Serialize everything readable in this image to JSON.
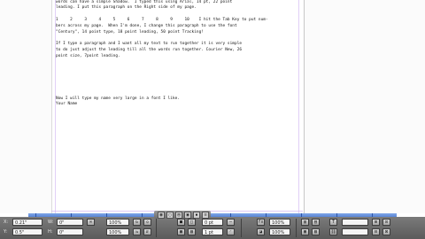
{
  "document": {
    "lines": [
      "words can have a simple Shadow.  I typed this using Arial, 14 pt, 22 point",
      "leading. I put this paragraph on the Right side of my page.",
      "",
      "1     2     3     4     5     6     7     8     9     10    I hit the Tab Key to put num-",
      "bers across my page.  When I'm done, I change this paragraph to use the font",
      "\"Century\", 14 point type, 18 point leading, 50 point Tracking!",
      "",
      "If I type a paragraph and I want all my text to run together it is very simple",
      "to do just adjust the leading till all the words run together. Courier New, 26",
      "point size, 7point leading."
    ],
    "lines_lower": [
      "Now I will type my name very large in a font I like.",
      "Your Name"
    ]
  },
  "control_panel": {
    "row1": {
      "x_value": "0.21\"",
      "w_value": "0\"",
      "zoom_value": "100%",
      "stroke_value": "0 pt",
      "opacity_value": "100%"
    },
    "row2": {
      "y_value": "0.5\"",
      "h_value": "0\"",
      "zoom2_value": "100%",
      "size_value": "1 pt",
      "tint_value": "100%"
    },
    "labels": {
      "x": "X:",
      "y": "Y:",
      "w": "W:",
      "h": "H:"
    },
    "accent": "#5a86d6",
    "panel_color": "#686868"
  }
}
